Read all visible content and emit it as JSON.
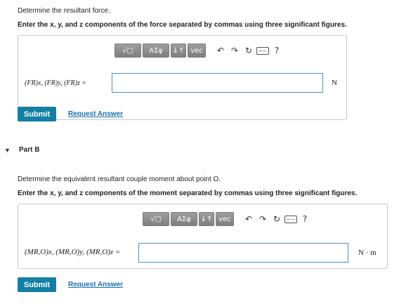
{
  "partA": {
    "question": "Determine the resultant force.",
    "instruction": "Enter the x, y, and z components of the force separated by commas using three significant figures.",
    "answer_label": "(FR)x, (FR)y, (FR)z =",
    "input_value": "",
    "unit": "N",
    "submit_label": "Submit",
    "request_label": "Request Answer"
  },
  "toolbar": {
    "math_label": "√▢",
    "greek_label": "ΑΣφ",
    "arrows_label": "↓↑",
    "vec_label": "vec",
    "help_label": "?"
  },
  "partB": {
    "title": "Part B",
    "question": "Determine the equivalent resultant couple moment about point O.",
    "instruction": "Enter the x, y, and z components of the moment separated by commas using three significant figures.",
    "answer_label": "(MR,O)x, (MR,O)y, (MR,O)z =",
    "input_value": "",
    "unit": "N · m",
    "submit_label": "Submit",
    "request_label": "Request Answer"
  }
}
